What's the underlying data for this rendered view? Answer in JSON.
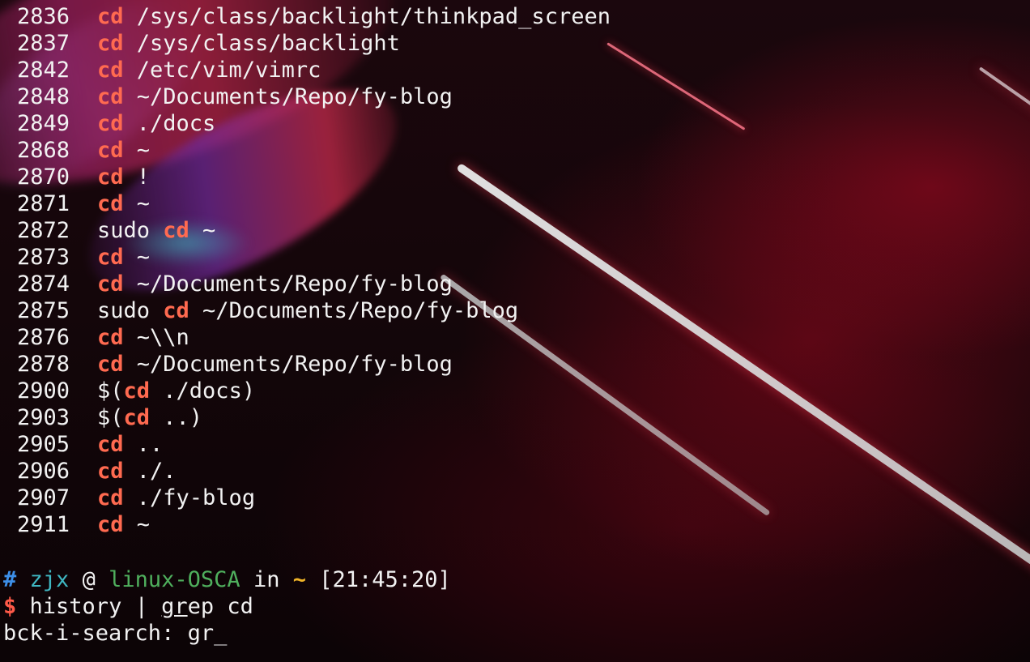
{
  "terminal": {
    "history": [
      {
        "num": "2836",
        "pre": "",
        "hl": "cd",
        "post": " /sys/class/backlight/thinkpad_screen"
      },
      {
        "num": "2837",
        "pre": "",
        "hl": "cd",
        "post": " /sys/class/backlight"
      },
      {
        "num": "2842",
        "pre": "",
        "hl": "cd",
        "post": " /etc/vim/vimrc"
      },
      {
        "num": "2848",
        "pre": "",
        "hl": "cd",
        "post": " ~/Documents/Repo/fy-blog"
      },
      {
        "num": "2849",
        "pre": "",
        "hl": "cd",
        "post": " ./docs"
      },
      {
        "num": "2868",
        "pre": "",
        "hl": "cd",
        "post": " ~"
      },
      {
        "num": "2870",
        "pre": "",
        "hl": "cd",
        "post": " !"
      },
      {
        "num": "2871",
        "pre": "",
        "hl": "cd",
        "post": " ~"
      },
      {
        "num": "2872",
        "pre": "sudo ",
        "hl": "cd",
        "post": " ~"
      },
      {
        "num": "2873",
        "pre": "",
        "hl": "cd",
        "post": " ~"
      },
      {
        "num": "2874",
        "pre": "",
        "hl": "cd",
        "post": " ~/Documents/Repo/fy-blog"
      },
      {
        "num": "2875",
        "pre": "sudo ",
        "hl": "cd",
        "post": " ~/Documents/Repo/fy-blog"
      },
      {
        "num": "2876",
        "pre": "",
        "hl": "cd",
        "post": " ~\\\\n"
      },
      {
        "num": "2878",
        "pre": "",
        "hl": "cd",
        "post": " ~/Documents/Repo/fy-blog"
      },
      {
        "num": "2900",
        "pre": "$(",
        "hl": "cd",
        "post": " ./docs)"
      },
      {
        "num": "2903",
        "pre": "$(",
        "hl": "cd",
        "post": " ..)"
      },
      {
        "num": "2905",
        "pre": "",
        "hl": "cd",
        "post": " .."
      },
      {
        "num": "2906",
        "pre": "",
        "hl": "cd",
        "post": " ./."
      },
      {
        "num": "2907",
        "pre": "",
        "hl": "cd",
        "post": " ./fy-blog"
      },
      {
        "num": "2911",
        "pre": "",
        "hl": "cd",
        "post": " ~"
      }
    ],
    "prompt": {
      "hash": "#",
      "user": "zjx",
      "at": "@",
      "host": "linux-OSCA",
      "in": "in",
      "dir": "~",
      "time": "[21:45:20]"
    },
    "command_line": {
      "dollar": "$",
      "part1": "history | ",
      "underlined": "gr",
      "part2": "ep cd"
    },
    "search_line": {
      "label": "bck-i-search: ",
      "query": "gr",
      "cursor": "_"
    }
  }
}
